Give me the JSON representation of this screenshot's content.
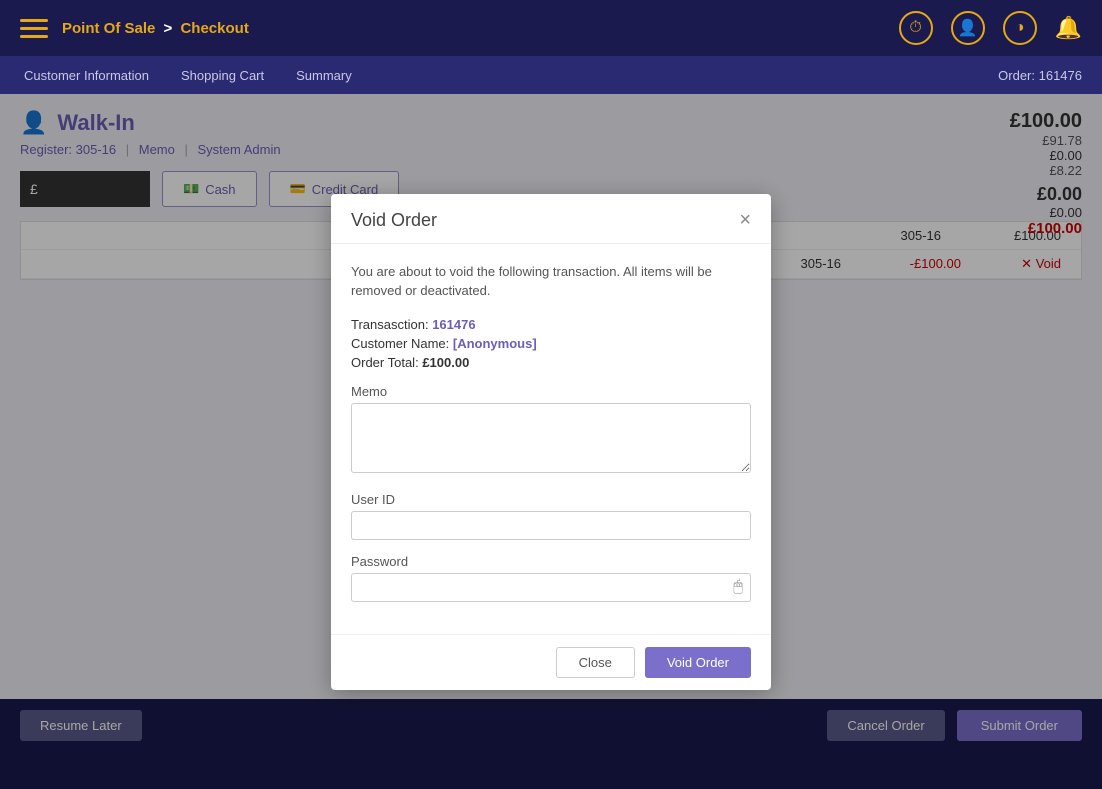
{
  "topNav": {
    "title": "Point Of Sale",
    "separator": ">",
    "subtitle": "Checkout",
    "icons": {
      "clock": "🕐",
      "user": "👤",
      "chart": "📊",
      "bell": "🔔"
    }
  },
  "secNav": {
    "items": [
      "Customer Information",
      "Shopping Cart",
      "Summary"
    ],
    "order": "Order: 161476"
  },
  "walkin": {
    "title": "Walk-In",
    "sub": {
      "register": "Register: 305-16",
      "memo": "Memo",
      "admin": "System Admin"
    }
  },
  "amounts": {
    "main": "£100.00",
    "sub1": "£91.78",
    "sub2": "£0.00",
    "sub3": "£8.22",
    "zero": "£0.00",
    "zero_red": "£0.00",
    "total_red": "£100.00"
  },
  "payment": {
    "pound_symbol": "£",
    "cash_label": "Cash",
    "credit_label": "Credit Card"
  },
  "table": {
    "rows": [
      {
        "register": "305-16",
        "amount": "£100.00"
      },
      {
        "register": "305-16",
        "amount": "-£100.00",
        "void_label": "Void",
        "is_void": true
      }
    ]
  },
  "bottomBar": {
    "resume_label": "Resume Later",
    "cancel_label": "Cancel Order",
    "submit_label": "Submit Order"
  },
  "modal": {
    "title": "Void Order",
    "close_icon": "×",
    "description": "You are about to void the following transaction. All items will be removed or deactivated.",
    "transaction_label": "Transasction:",
    "transaction_value": "161476",
    "customer_label": "Customer Name:",
    "customer_value": "[Anonymous]",
    "order_total_label": "Order Total:",
    "order_total_value": "£100.00",
    "memo_label": "Memo",
    "user_id_label": "User ID",
    "password_label": "Password",
    "close_button": "Close",
    "void_button": "Void Order",
    "password_icon": "🖱"
  }
}
